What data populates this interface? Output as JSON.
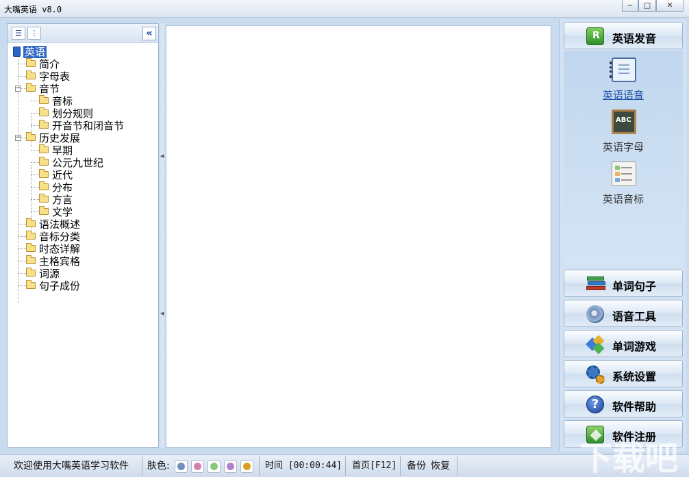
{
  "window": {
    "title": "大嘴英语 v8.0",
    "minimize": "−",
    "maximize": "□",
    "close": "✕"
  },
  "tree": {
    "root": "英语",
    "items": [
      {
        "label": "简介"
      },
      {
        "label": "字母表"
      },
      {
        "label": "音节",
        "expander": "−"
      },
      {
        "label": "音标"
      },
      {
        "label": "划分规则"
      },
      {
        "label": "开音节和闭音节"
      },
      {
        "label": "历史发展",
        "expander": "−"
      },
      {
        "label": "早期"
      },
      {
        "label": "公元九世纪"
      },
      {
        "label": "近代"
      },
      {
        "label": "分布"
      },
      {
        "label": "方言"
      },
      {
        "label": "文学"
      },
      {
        "label": "语法概述"
      },
      {
        "label": "音标分类"
      },
      {
        "label": "时态详解"
      },
      {
        "label": "主格宾格"
      },
      {
        "label": "词源"
      },
      {
        "label": "句子成份"
      }
    ],
    "collapse_glyph": "«"
  },
  "nav": {
    "active_section": "英语发音",
    "sub_items": [
      {
        "label": "英语语音",
        "icon": "notebook-icon"
      },
      {
        "label": "英语字母",
        "icon": "abc-board-icon"
      },
      {
        "label": "英语音标",
        "icon": "phonetic-chart-icon"
      }
    ],
    "abc_text": "ABC",
    "sections": [
      {
        "label": "单词句子",
        "icon": "books-icon"
      },
      {
        "label": "语音工具",
        "icon": "audio-tool-icon"
      },
      {
        "label": "单词游戏",
        "icon": "game-cubes-icon"
      },
      {
        "label": "系统设置",
        "icon": "gears-icon"
      },
      {
        "label": "软件帮助",
        "icon": "help-icon"
      },
      {
        "label": "软件注册",
        "icon": "register-icon"
      }
    ],
    "help_glyph": "?",
    "r_glyph": "R"
  },
  "status": {
    "welcome": "欢迎使用大嘴英语学习软件",
    "skin_label": "肤色:",
    "skin_colors": [
      "#6f8fbd",
      "#d77fae",
      "#86c77b",
      "#b07fd0",
      "#d9a11e"
    ],
    "time": "时间 [00:00:44]",
    "home": "首页[F12]",
    "backup": "备份",
    "restore": "恢复"
  },
  "watermark": "下载吧"
}
